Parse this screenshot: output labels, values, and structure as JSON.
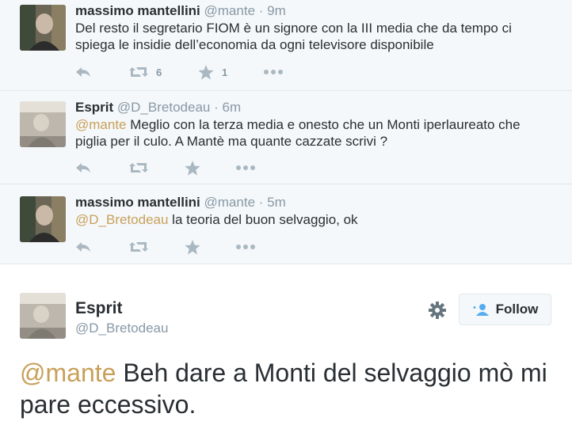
{
  "thread": [
    {
      "fullname": "massimo mantellini",
      "handle": "@mante",
      "time": "9m",
      "mention": "",
      "text": "Del resto il segretario FIOM è un signore con la III media che da tempo ci spiega le insidie dell’economia da ogni televisore disponibile",
      "retweet_count": "6",
      "favorite_count": "1"
    },
    {
      "fullname": "Esprit",
      "handle": "@D_Bretodeau",
      "time": "6m",
      "mention": "@mante",
      "text": " Meglio con la terza media e onesto che un Monti iperlaureato che piglia per il culo. A Mantè ma quante cazzate scrivi ?",
      "retweet_count": "",
      "favorite_count": ""
    },
    {
      "fullname": "massimo mantellini",
      "handle": "@mante",
      "time": "5m",
      "mention": "@D_Bretodeau",
      "text": " la teoria del buon selvaggio, ok",
      "retweet_count": "",
      "favorite_count": ""
    }
  ],
  "separator": "·",
  "main": {
    "fullname": "Esprit",
    "handle": "@D_Bretodeau",
    "follow_label": "Follow",
    "mention": "@mante",
    "text": " Beh dare a Monti del selvaggio mò mi pare eccessivo."
  },
  "icons": [
    "reply-icon",
    "retweet-icon",
    "favorite-icon",
    "more-icon",
    "gear-icon",
    "follow-user-icon"
  ],
  "colors": {
    "mention": "#c8a05a",
    "action_gray": "#aab8c2",
    "muted": "#8899a6",
    "thread_bg": "#f5f8fa"
  }
}
